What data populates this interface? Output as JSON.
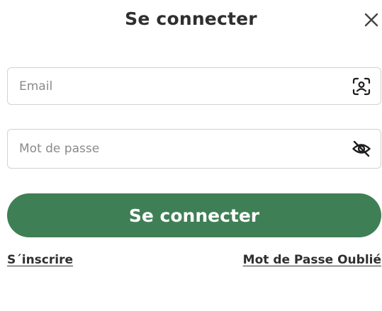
{
  "header": {
    "title": "Se connecter",
    "close_icon": "close-icon"
  },
  "form": {
    "email_placeholder": "Email",
    "email_value": "",
    "email_icon": "face-scan-icon",
    "password_placeholder": "Mot de passe",
    "password_value": "",
    "password_icon": "eye-off-icon",
    "submit_label": "Se connecter"
  },
  "links": {
    "signup_label": "S´inscrire",
    "forgot_label": "Mot de Passe Oublié"
  },
  "colors": {
    "primary_button": "#3f7f55",
    "text": "#2f2f2f",
    "border": "#d2d2d2",
    "placeholder": "#8a8a8a"
  }
}
